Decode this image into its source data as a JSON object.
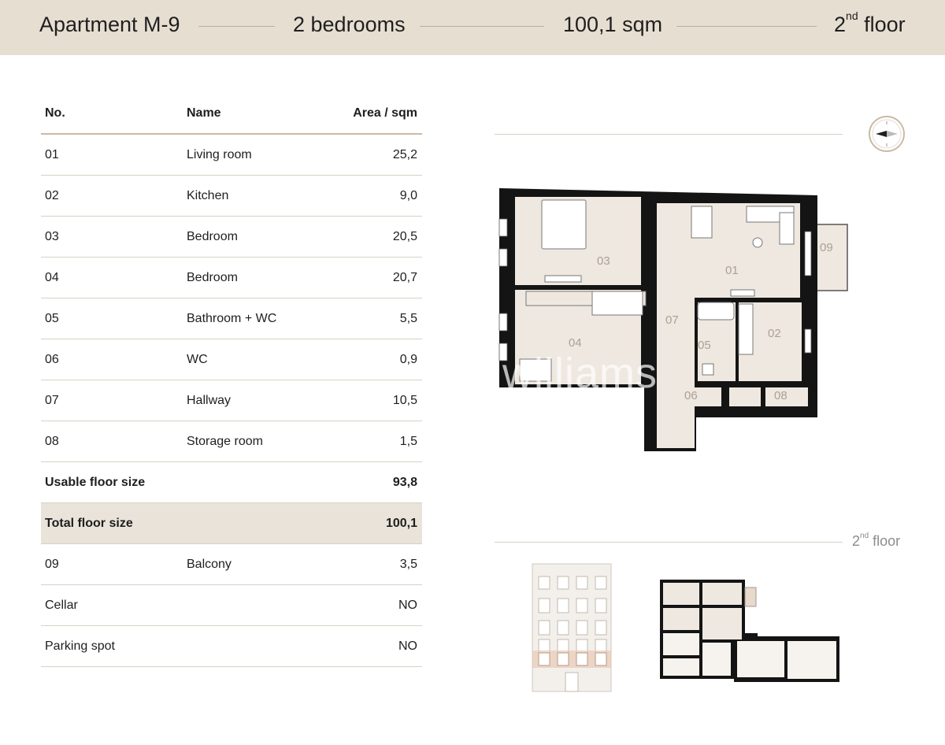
{
  "header": {
    "apartment": "Apartment M-9",
    "bedrooms": "2 bedrooms",
    "area": "100,1 sqm",
    "floor_num": "2",
    "floor_sup": "nd",
    "floor_word": "floor"
  },
  "table": {
    "col_no": "No.",
    "col_name": "Name",
    "col_area": "Area / sqm",
    "rows": [
      {
        "no": "01",
        "name": "Living room",
        "area": "25,2"
      },
      {
        "no": "02",
        "name": "Kitchen",
        "area": "9,0"
      },
      {
        "no": "03",
        "name": "Bedroom",
        "area": "20,5"
      },
      {
        "no": "04",
        "name": "Bedroom",
        "area": "20,7"
      },
      {
        "no": "05",
        "name": "Bathroom + WC",
        "area": "5,5"
      },
      {
        "no": "06",
        "name": "WC",
        "area": "0,9"
      },
      {
        "no": "07",
        "name": "Hallway",
        "area": "10,5"
      },
      {
        "no": "08",
        "name": "Storage room",
        "area": "1,5"
      }
    ],
    "usable_label": "Usable floor size",
    "usable_value": "93,8",
    "total_label": "Total floor size",
    "total_value": "100,1",
    "extras": [
      {
        "no": "09",
        "name": "Balcony",
        "area": "3,5"
      },
      {
        "no": "Cellar",
        "name": "",
        "area": "NO"
      },
      {
        "no": "Parking spot",
        "name": "",
        "area": "NO"
      }
    ]
  },
  "plan": {
    "room_labels": [
      "01",
      "02",
      "03",
      "04",
      "05",
      "06",
      "07",
      "08",
      "09"
    ],
    "watermark": "williams",
    "floor_num": "2",
    "floor_sup": "nd",
    "floor_word": "floor"
  },
  "colors": {
    "header_bg": "#e7ded2",
    "accent": "#c9bba5",
    "room_fill": "#efe8e0",
    "wall": "#141414",
    "facade_highlight": "#e8c9b5"
  }
}
